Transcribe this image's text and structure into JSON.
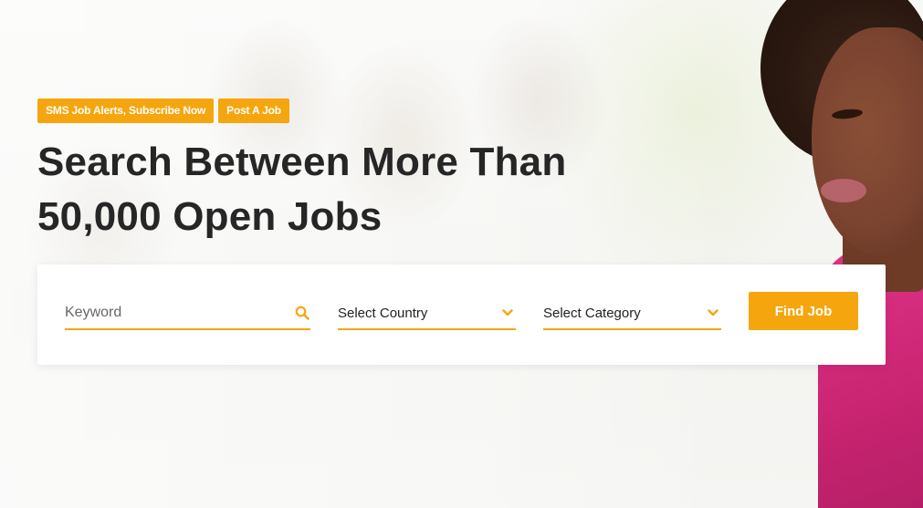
{
  "hero": {
    "badges": [
      {
        "label": "SMS Job Alerts, Subscribe Now"
      },
      {
        "label": "Post A Job"
      }
    ],
    "headline_line1": "Search Between More Than",
    "headline_line2": "50,000 Open Jobs"
  },
  "search": {
    "keyword_placeholder": "Keyword",
    "keyword_icon": "search-icon",
    "country_label": "Select Country",
    "country_icon": "chevron-down-icon",
    "category_label": "Select Category",
    "category_icon": "chevron-down-icon",
    "submit_label": "Find Job"
  },
  "colors": {
    "accent": "#f5a60e",
    "heading": "#262626"
  }
}
